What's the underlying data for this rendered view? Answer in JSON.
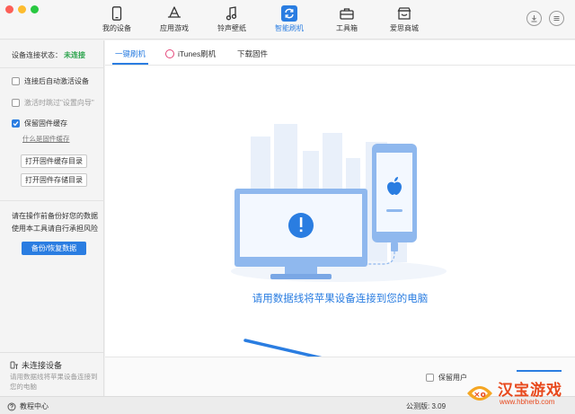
{
  "window": {
    "traffic_lights": [
      "close",
      "minimize",
      "zoom"
    ]
  },
  "nav": [
    {
      "label": "我的设备",
      "icon": "phone-icon",
      "active": false
    },
    {
      "label": "应用游戏",
      "icon": "app-store-icon",
      "active": false
    },
    {
      "label": "铃声壁纸",
      "icon": "music-note-icon",
      "active": false
    },
    {
      "label": "智能刷机",
      "icon": "refresh-icon",
      "active": true
    },
    {
      "label": "工具箱",
      "icon": "toolbox-icon",
      "active": false
    },
    {
      "label": "爱思商城",
      "icon": "store-icon",
      "active": false
    }
  ],
  "sidebar": {
    "status_label": "设备连接状态：",
    "status_value": "未连接",
    "options": [
      {
        "label": "连接后自动激活设备",
        "checked": false,
        "enabled": true
      },
      {
        "label": "激活时跳过\"设置向导\"",
        "checked": false,
        "enabled": false
      },
      {
        "label": "保留固件缓存",
        "checked": true,
        "enabled": true
      }
    ],
    "cache_link": "什么是固件缓存",
    "open_cache_btn": "打开固件缓存目录",
    "open_store_btn": "打开固件存储目录",
    "warning_line1": "请在操作前备份好您的数据",
    "warning_line2": "使用本工具请自行承担风险",
    "backup_btn": "备份/恢复数据",
    "device_title": "未连接设备",
    "device_sub": "请用数据线将苹果设备连接到您的电脑"
  },
  "tabs": [
    {
      "label": "一键刷机",
      "active": true
    },
    {
      "label": "iTunes刷机",
      "active": false
    },
    {
      "label": "下载固件",
      "active": false
    }
  ],
  "main": {
    "connect_message": "请用数据线将苹果设备连接到您的电脑",
    "keep_user_data": "保留用户"
  },
  "statusbar": {
    "tutorial": "教程中心",
    "version": "公测版: 3.09"
  },
  "watermark": {
    "title": "汉宝游戏",
    "url": "www.hbherb.com"
  },
  "colors": {
    "accent": "#2a7de1",
    "ok": "#2da44e",
    "watermark": "#e8491d"
  }
}
